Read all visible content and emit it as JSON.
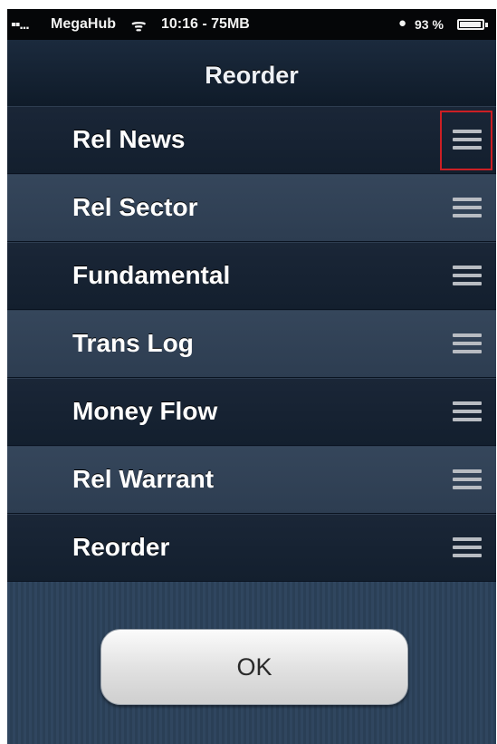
{
  "status_bar": {
    "signal": "▪▪...",
    "carrier": "MegaHub",
    "wifi_icon": "wifi-icon",
    "time_memory": "10:16 - 75MB",
    "chat_icon": "chat-bubble-icon",
    "battery_percent": "93 %",
    "battery_icon": "battery-icon"
  },
  "navbar": {
    "title": "Reorder"
  },
  "list": {
    "items": [
      {
        "label": "Rel News",
        "style": "dark",
        "highlighted": true
      },
      {
        "label": "Rel Sector",
        "style": "light",
        "highlighted": false
      },
      {
        "label": "Fundamental",
        "style": "dark",
        "highlighted": false
      },
      {
        "label": "Trans Log",
        "style": "light",
        "highlighted": false
      },
      {
        "label": "Money Flow",
        "style": "dark",
        "highlighted": false
      },
      {
        "label": "Rel Warrant",
        "style": "light",
        "highlighted": false
      },
      {
        "label": "Reorder",
        "style": "dark",
        "highlighted": false
      }
    ],
    "handle_icon": "reorder-handle-icon",
    "highlight_color": "#cc1f24"
  },
  "footer": {
    "ok_label": "OK"
  }
}
